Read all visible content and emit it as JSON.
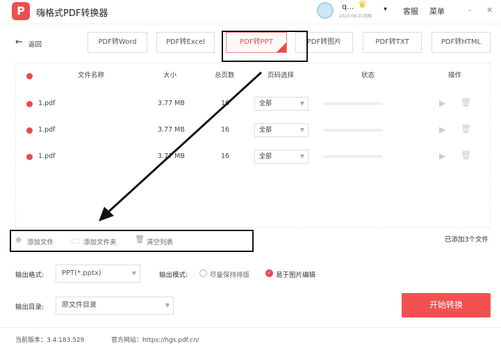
{
  "app": {
    "title": "嗨格式PDF转换器",
    "logo": "P"
  },
  "user": {
    "name": "q...",
    "expiry": "2023-08-31到期",
    "menu_caret": "▾"
  },
  "titlebar": {
    "service": "客服",
    "menu": "菜单",
    "minimize": "–",
    "close": "✕"
  },
  "nav": {
    "back": "返回",
    "tabs": [
      "PDF转Word",
      "PDF转Excel",
      "PDF转PPT",
      "PDF转图片",
      "PDF转TXT",
      "PDF转HTML"
    ],
    "active": 2
  },
  "table": {
    "headers": [
      "文件名称",
      "大小",
      "总页数",
      "页码选择",
      "状态",
      "操作"
    ],
    "rows": [
      {
        "name": "1.pdf",
        "size": "3.77 MB",
        "pages": "16",
        "range": "全部",
        "progress": 0
      },
      {
        "name": "1.pdf",
        "size": "3.77 MB",
        "pages": "16",
        "range": "全部",
        "progress": 0
      },
      {
        "name": "1.pdf",
        "size": "3.77 MB",
        "pages": "16",
        "range": "全部",
        "progress": 0
      }
    ]
  },
  "toolbar": {
    "add_file": "添加文件",
    "add_folder": "添加文件夹",
    "clear": "清空列表",
    "count": "已添加3个文件"
  },
  "output": {
    "format_label": "输出格式:",
    "format_value": "PPT(*.pptx)",
    "mode_label": "输出模式:",
    "mode_options": [
      "尽量保持排版",
      "易于图片编辑"
    ],
    "mode_selected": 1,
    "dir_label": "输出目录:",
    "dir_value": "原文件目录"
  },
  "start": "开始转换",
  "footer": {
    "version": "当前版本：3.4.183.529",
    "site": "官方网站：https://hgs.pdf.cn/"
  },
  "colors": {
    "accent": "#f25050"
  }
}
